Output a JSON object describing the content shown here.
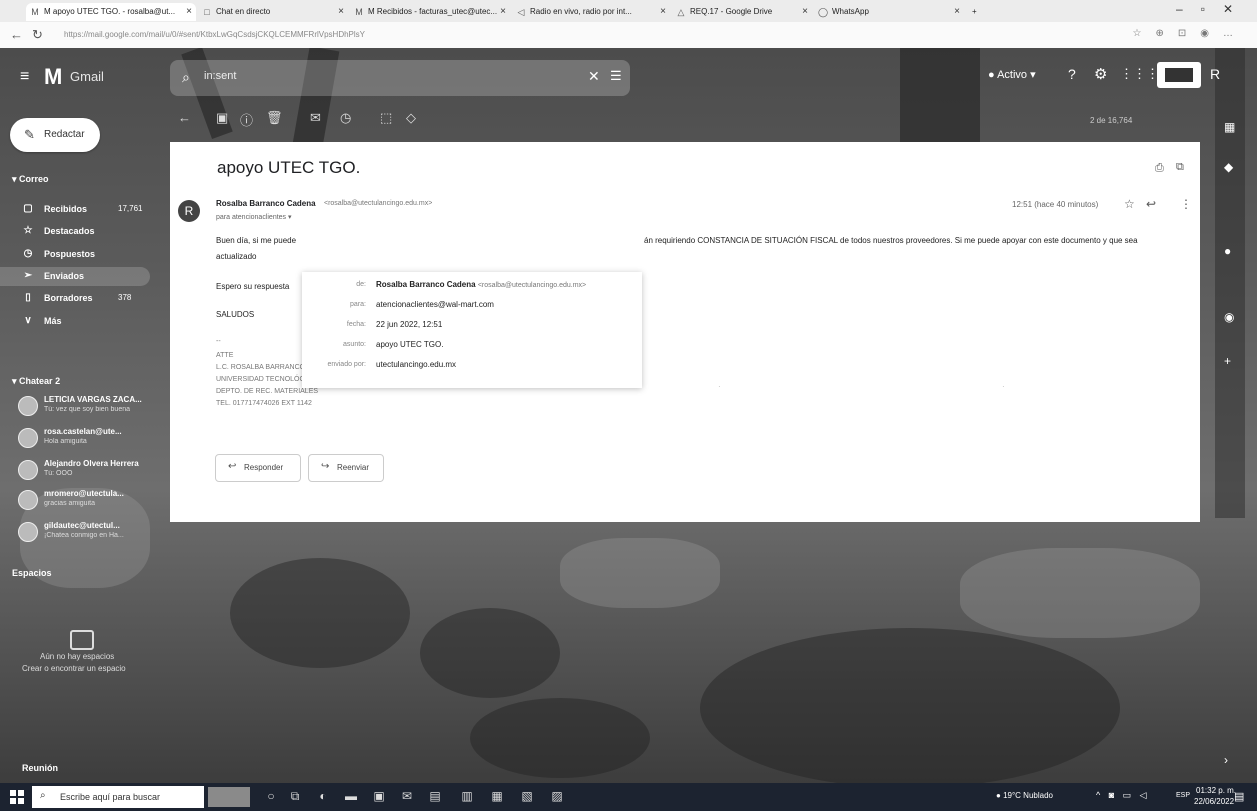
{
  "browser": {
    "tabs": [
      {
        "label": "M apoyo UTEC TGO. - rosalba@ut...",
        "active": true
      },
      {
        "label": "Chat en directo",
        "active": false
      },
      {
        "label": "M Recibidos - facturas_utec@utec...",
        "active": false
      },
      {
        "label": "Radio en vivo, radio por int...",
        "active": false
      },
      {
        "label": "REQ.17 - Google Drive",
        "active": false
      },
      {
        "label": "WhatsApp",
        "active": false
      }
    ],
    "url": "https://mail.google.com/mail/u/0/#sent/KtbxLwGqCsdsjCKQLCEMMFRrlVpsHDhPlsY"
  },
  "gmail": {
    "app_name": "Gmail",
    "search_value": "in:sent",
    "status": "Activo",
    "compose_label": "Redactar",
    "sections": {
      "mail": "Correo",
      "chat": "Chatear",
      "chat_count": "2",
      "spaces": "Espacios",
      "meet": "Reunión"
    },
    "nav": [
      {
        "label": "Recibidos",
        "count": "17,761",
        "icon": "inbox-icon"
      },
      {
        "label": "Destacados",
        "count": "",
        "icon": "star-icon"
      },
      {
        "label": "Pospuestos",
        "count": "",
        "icon": "clock-icon"
      },
      {
        "label": "Enviados",
        "count": "",
        "icon": "send-icon"
      },
      {
        "label": "Borradores",
        "count": "378",
        "icon": "draft-icon"
      },
      {
        "label": "Más",
        "count": "",
        "icon": "chevron-down-icon"
      }
    ],
    "chats": [
      {
        "name": "LETICIA VARGAS ZACA...",
        "message": "Tú: vez que soy bien buena"
      },
      {
        "name": "rosa.castelan@ute...",
        "message": "Hola amiguita"
      },
      {
        "name": "Alejandro Olvera Herrera",
        "message": "Tú: OOO"
      },
      {
        "name": "mromero@utectula...",
        "message": "gracias amiguita"
      },
      {
        "name": "gildautec@utectul...",
        "message": "¡Chatea conmigo en Ha..."
      }
    ],
    "spaces_empty": "Aún no hay espacios",
    "spaces_find": "Crear o encontrar un espacio",
    "pager": "2 de 16,764"
  },
  "email": {
    "subject": "apoyo UTEC TGO.",
    "sender_initial": "R",
    "sender_name": "Rosalba Barranco Cadena",
    "sender_email": "<rosalba@utectulancingo.edu.mx>",
    "to_line": "para atencionaclientes ▾",
    "timestamp": "12:51 (hace 40 minutos)",
    "body": {
      "line1a": "Buen día, si me puede",
      "line1b": "án requiriendo CONSTANCIA DE SITUACIÓN FISCAL de todos nuestros proveedores. Si me puede apoyar con este documento y que sea",
      "line2": "actualizado",
      "line3": "Espero su respuesta",
      "line4": "SALUDOS"
    },
    "signature": [
      "--",
      "ATTE",
      "L.C. ROSALBA BARRANCO CADENA",
      "UNIVERSIDAD TECNOLÓGICA DE TULANCINGO",
      "DEPTO. DE REC. MATERIALES",
      "TEL. 017717474026 EXT 1142"
    ],
    "reply_label": "Responder",
    "forward_label": "Reenviar",
    "details": {
      "de_label": "de:",
      "de_name": "Rosalba Barranco Cadena",
      "de_email": "<rosalba@utectulancingo.edu.mx>",
      "para_label": "para:",
      "para_value": "atencionaclientes@wal-mart.com",
      "fecha_label": "fecha:",
      "fecha_value": "22 jun 2022, 12:51",
      "asunto_label": "asunto:",
      "asunto_value": "apoyo UTEC TGO.",
      "enviado_label": "enviado por:",
      "enviado_value": "utectulancingo.edu.mx"
    }
  },
  "taskbar": {
    "search_placeholder": "Escribe aquí para buscar",
    "weather": "19°C Nublado",
    "lang": "ESP",
    "time": "01:32 p. m.",
    "date": "22/06/2022"
  }
}
